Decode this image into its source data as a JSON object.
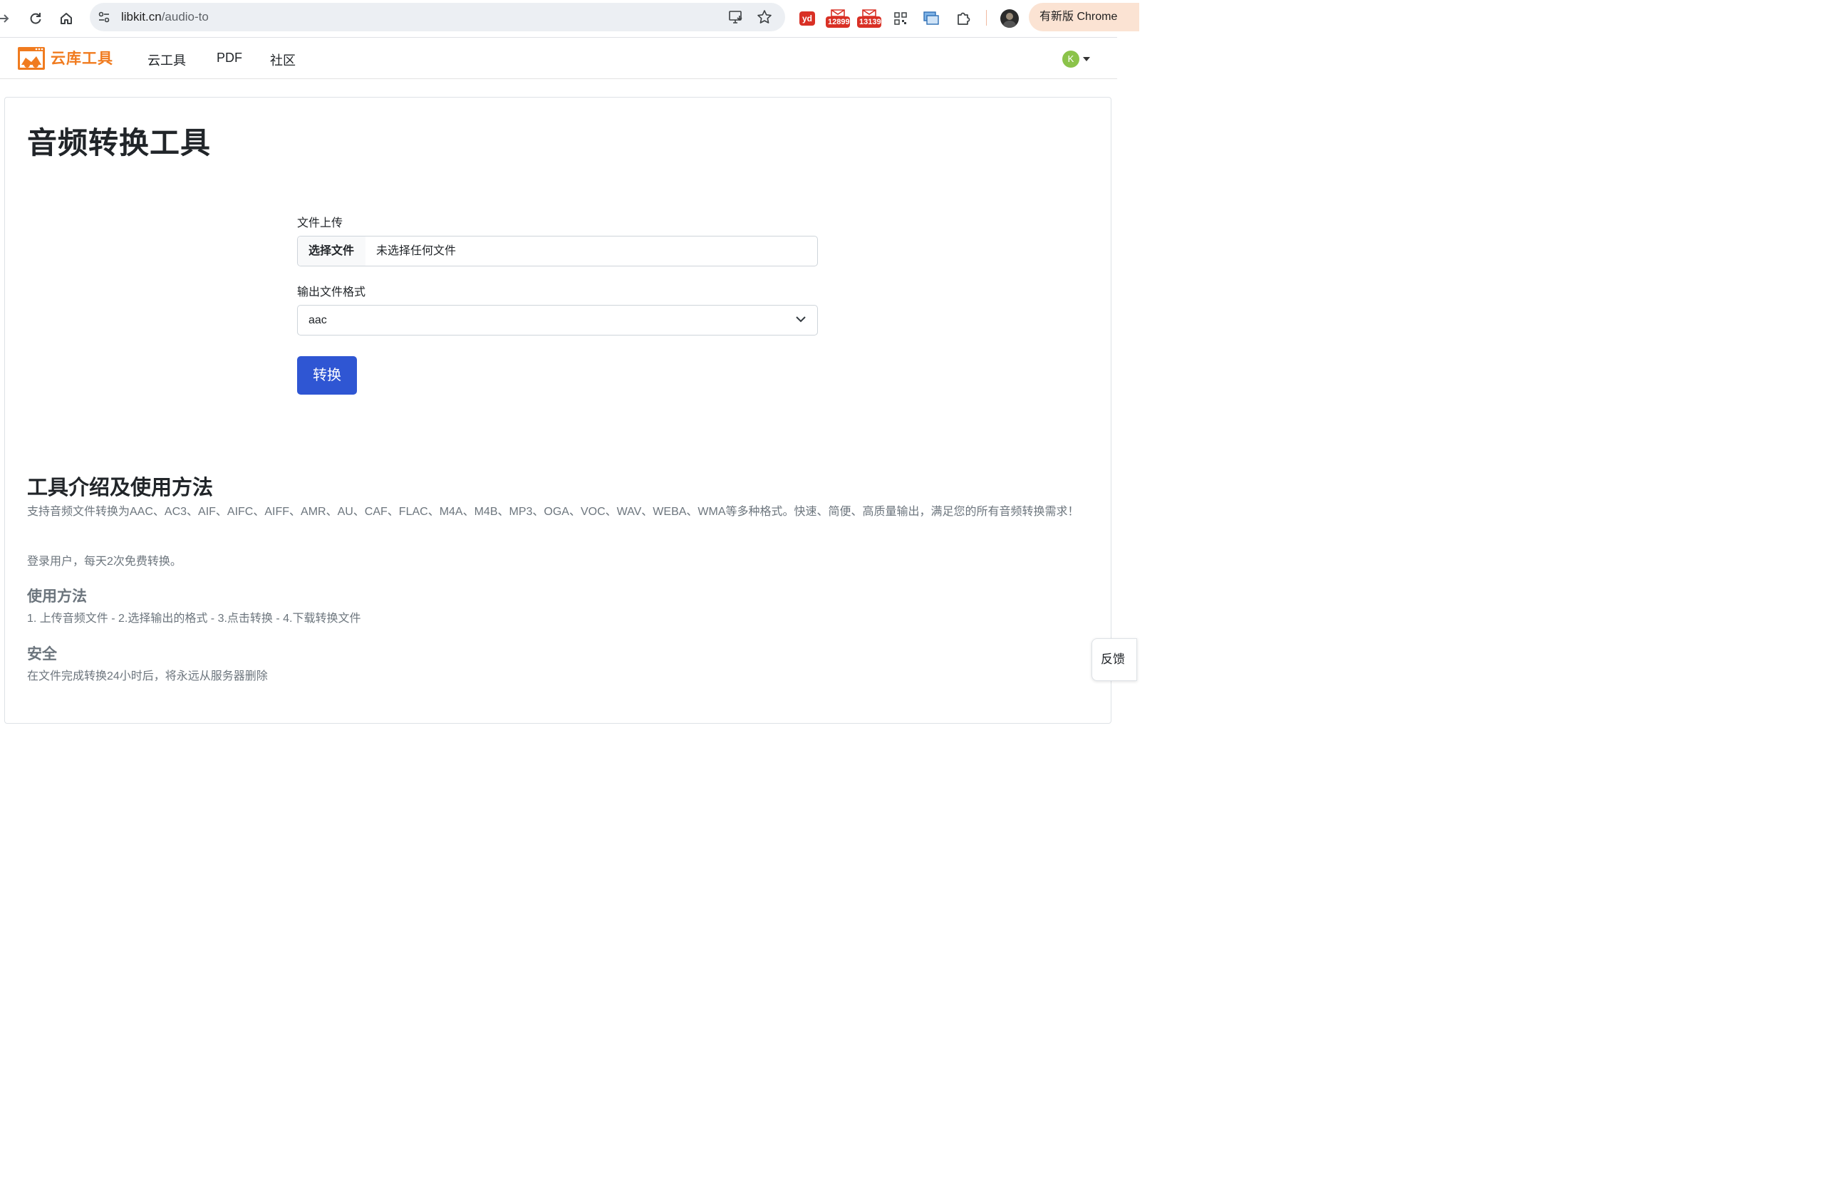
{
  "browser": {
    "url_domain": "libkit.cn",
    "url_path": "/audio-to",
    "extensions": {
      "yd": "yd",
      "mail1_count": "12899",
      "mail2_count": "13139"
    },
    "update_label": "有新版 Chrome"
  },
  "nav": {
    "brand": "云库工具",
    "links": [
      "云工具",
      "PDF",
      "社区"
    ],
    "avatar_initial": "K"
  },
  "page": {
    "title": "音频转换工具",
    "upload_label": "文件上传",
    "choose_file_label": "选择文件",
    "no_file_text": "未选择任何文件",
    "format_label": "输出文件格式",
    "format_value": "aac",
    "convert_label": "转换"
  },
  "intro": {
    "title": "工具介绍及使用方法",
    "description": "支持音频文件转换为AAC、AC3、AIF、AIFC、AIFF、AMR、AU、CAF、FLAC、M4A、M4B、MP3、OGA、VOC、WAV、WEBA、WMA等多种格式。快速、简便、高质量输出，满足您的所有音频转换需求！",
    "quota": "登录用户，每天2次免费转换。",
    "usage_title": "使用方法",
    "usage_steps": "1. 上传音频文件 - 2.选择输出的格式 - 3.点击转换 - 4.下载转换文件",
    "security_title": "安全",
    "security_text": "在文件完成转换24小时后，将永远从服务器删除"
  },
  "feedback_label": "反馈",
  "colors": {
    "brand": "#f07b1f",
    "primary_button": "#2f56d3",
    "muted_text": "#6c757d"
  }
}
